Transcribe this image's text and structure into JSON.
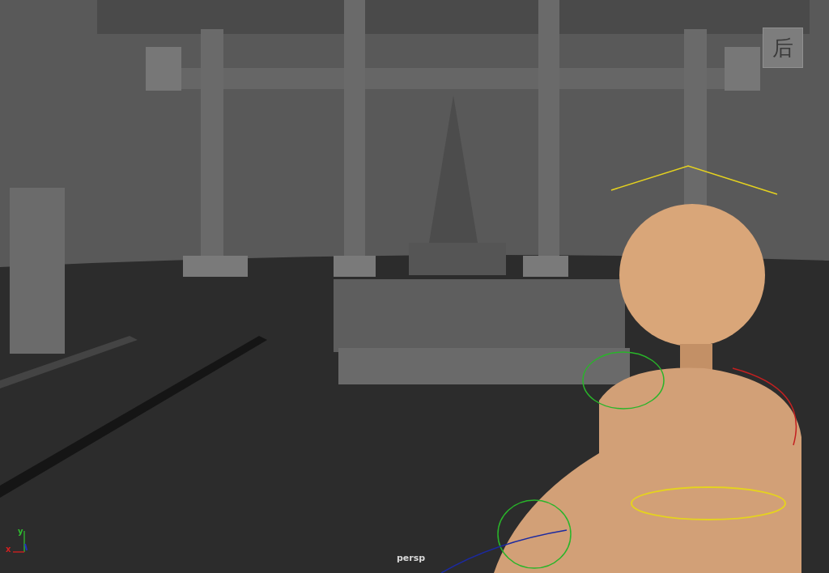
{
  "viewport": {
    "camera_label": "persp",
    "view_cube": {
      "label": "后"
    },
    "axis_gizmo": {
      "x_label": "x",
      "y_label": "y"
    }
  }
}
